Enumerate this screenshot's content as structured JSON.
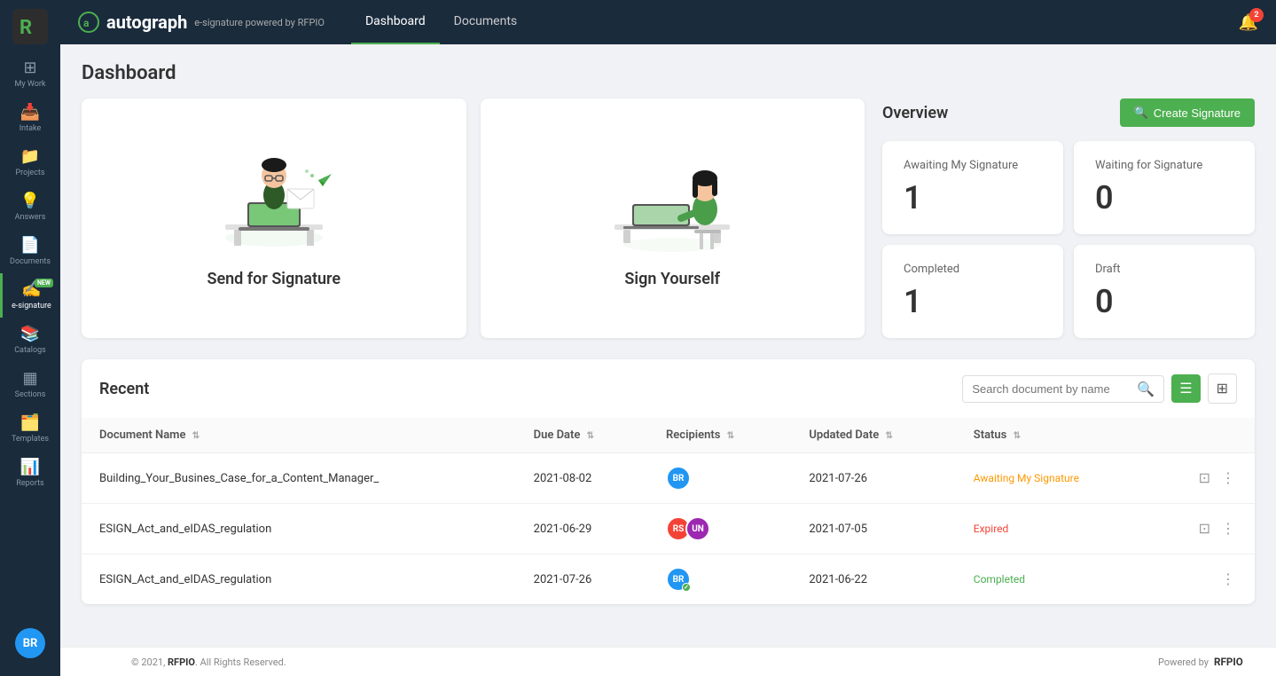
{
  "app": {
    "name": "autograph",
    "tagline": "e-signature powered by RFPIO"
  },
  "topnav": {
    "tabs": [
      {
        "id": "dashboard",
        "label": "Dashboard",
        "active": true
      },
      {
        "id": "documents",
        "label": "Documents",
        "active": false
      }
    ],
    "notification_count": "2"
  },
  "sidebar": {
    "items": [
      {
        "id": "my-work",
        "label": "My Work",
        "icon": "⊞"
      },
      {
        "id": "intake",
        "label": "Intake",
        "icon": "📥"
      },
      {
        "id": "projects",
        "label": "Projects",
        "icon": "📁"
      },
      {
        "id": "answers",
        "label": "Answers",
        "icon": "💡"
      },
      {
        "id": "documents",
        "label": "Documents",
        "icon": "📄"
      },
      {
        "id": "e-signature",
        "label": "e-signature",
        "icon": "✍️",
        "new": true,
        "active": true
      },
      {
        "id": "catalogs",
        "label": "Catalogs",
        "icon": "📚"
      },
      {
        "id": "sections",
        "label": "Sections",
        "icon": "▦"
      },
      {
        "id": "templates",
        "label": "Templates",
        "icon": "🗂️"
      },
      {
        "id": "reports",
        "label": "Reports",
        "icon": "📊"
      }
    ],
    "user": {
      "initials": "BR",
      "color": "#2196F3"
    }
  },
  "dashboard": {
    "title": "Dashboard",
    "action_cards": [
      {
        "id": "send",
        "title": "Send for Signature"
      },
      {
        "id": "sign",
        "title": "Sign Yourself"
      }
    ],
    "overview": {
      "title": "Overview",
      "create_btn": "Create Signature",
      "stats": [
        {
          "id": "awaiting",
          "label": "Awaiting My Signature",
          "value": "1"
        },
        {
          "id": "waiting",
          "label": "Waiting for Signature",
          "value": "0"
        },
        {
          "id": "completed",
          "label": "Completed",
          "value": "1"
        },
        {
          "id": "draft",
          "label": "Draft",
          "value": "0"
        }
      ]
    },
    "recent": {
      "title": "Recent",
      "search_placeholder": "Search document by name",
      "table": {
        "columns": [
          {
            "id": "name",
            "label": "Document Name"
          },
          {
            "id": "due_date",
            "label": "Due Date"
          },
          {
            "id": "recipients",
            "label": "Recipients"
          },
          {
            "id": "updated_date",
            "label": "Updated Date"
          },
          {
            "id": "status",
            "label": "Status"
          }
        ],
        "rows": [
          {
            "id": 1,
            "name": "Building_Your_Busines_Case_for_a_Content_Manager_",
            "due_date": "2021-08-02",
            "recipients": [
              {
                "initials": "BR",
                "color": "#2196F3"
              }
            ],
            "updated_date": "2021-07-26",
            "status": "Awaiting My Signature",
            "status_class": "status-awaiting"
          },
          {
            "id": 2,
            "name": "ESIGN_Act_and_eIDAS_regulation",
            "due_date": "2021-06-29",
            "recipients": [
              {
                "initials": "RS",
                "color": "#f44336"
              },
              {
                "initials": "UN",
                "color": "#9c27b0"
              }
            ],
            "updated_date": "2021-07-05",
            "status": "Expired",
            "status_class": "status-expired"
          },
          {
            "id": 3,
            "name": "ESIGN_Act_and_eIDAS_regulation",
            "due_date": "2021-07-26",
            "recipients": [
              {
                "initials": "BR",
                "color": "#2196F3",
                "check": true
              }
            ],
            "updated_date": "2021-06-22",
            "status": "Completed",
            "status_class": "status-completed"
          }
        ]
      }
    }
  },
  "footer": {
    "copyright": "© 2021,",
    "company": "RFPIO",
    "rights": ". All Rights Reserved.",
    "powered_by": "Powered by"
  }
}
